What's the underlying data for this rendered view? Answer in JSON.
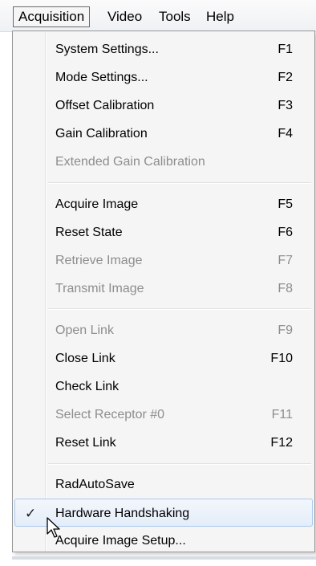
{
  "menubar": {
    "items": [
      {
        "label": "Acquisition"
      },
      {
        "label": "Video"
      },
      {
        "label": "Tools"
      },
      {
        "label": "Help"
      }
    ]
  },
  "menu": {
    "items": [
      {
        "label": "System Settings...",
        "shortcut": "F1",
        "enabled": true
      },
      {
        "label": "Mode Settings...",
        "shortcut": "F2",
        "enabled": true
      },
      {
        "label": "Offset Calibration",
        "shortcut": "F3",
        "enabled": true
      },
      {
        "label": "Gain Calibration",
        "shortcut": "F4",
        "enabled": true
      },
      {
        "label": "Extended Gain Calibration",
        "shortcut": "",
        "enabled": false
      },
      {
        "label": "Acquire Image",
        "shortcut": "F5",
        "enabled": true
      },
      {
        "label": "Reset State",
        "shortcut": "F6",
        "enabled": true
      },
      {
        "label": "Retrieve Image",
        "shortcut": "F7",
        "enabled": false
      },
      {
        "label": "Transmit Image",
        "shortcut": "F8",
        "enabled": false
      },
      {
        "label": "Open Link",
        "shortcut": "F9",
        "enabled": false
      },
      {
        "label": "Close Link",
        "shortcut": "F10",
        "enabled": true
      },
      {
        "label": "Check Link",
        "shortcut": "",
        "enabled": true
      },
      {
        "label": "Select Receptor #0",
        "shortcut": "F11",
        "enabled": false
      },
      {
        "label": "Reset Link",
        "shortcut": "F12",
        "enabled": true
      },
      {
        "label": "RadAutoSave",
        "shortcut": "",
        "enabled": true
      },
      {
        "label": "Hardware Handshaking",
        "shortcut": "",
        "enabled": true,
        "checked": true,
        "check_mark": "✓"
      },
      {
        "label": "Acquire Image Setup...",
        "shortcut": "",
        "enabled": true
      }
    ]
  },
  "colors": {
    "disabled_text": "#8d8d8d",
    "highlight_border": "#a8c8ee",
    "menu_background": "#f5f5f5"
  },
  "icons": {
    "cursor": "mouse-pointer-icon",
    "check": "checkmark-icon"
  }
}
